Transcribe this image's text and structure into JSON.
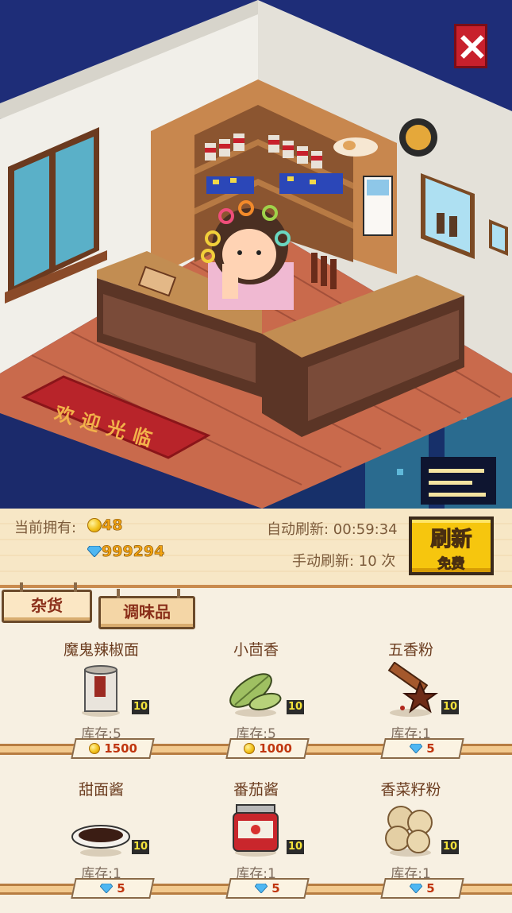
{
  "status": {
    "owned_label": "当前拥有:",
    "coins": "48",
    "gems": "999294",
    "auto_refresh_label": "自动刷新: 00:59:34",
    "manual_refresh_label": "手动刷新: 10 次",
    "refresh_button": "刷新",
    "refresh_cost": "免费"
  },
  "scene": {
    "welcome_mat": "欢迎光临"
  },
  "tabs": [
    {
      "label": "杂货",
      "active": true
    },
    {
      "label": "调味品",
      "active": false
    }
  ],
  "items": [
    {
      "name": "魔鬼辣椒面",
      "icon": "chili-powder-can-icon",
      "qty": "10",
      "stock": "库存:5",
      "currency": "coin",
      "price": "1500"
    },
    {
      "name": "小茴香",
      "icon": "fennel-seed-icon",
      "qty": "10",
      "stock": "库存:5",
      "currency": "coin",
      "price": "1000"
    },
    {
      "name": "五香粉",
      "icon": "five-spice-icon",
      "qty": "10",
      "stock": "库存:1",
      "currency": "gem",
      "price": "5"
    },
    {
      "name": "甜面酱",
      "icon": "sweet-bean-sauce-bowl-icon",
      "qty": "10",
      "stock": "库存:1",
      "currency": "gem",
      "price": "5"
    },
    {
      "name": "番茄酱",
      "icon": "ketchup-jar-icon",
      "qty": "10",
      "stock": "库存:1",
      "currency": "gem",
      "price": "5"
    },
    {
      "name": "香菜籽粉",
      "icon": "coriander-seed-icon",
      "qty": "10",
      "stock": "库存:1",
      "currency": "gem",
      "price": "5"
    }
  ],
  "colors": {
    "accent": "#f6c60e",
    "price_red": "#c0360e",
    "wood": "#c98b4e"
  }
}
